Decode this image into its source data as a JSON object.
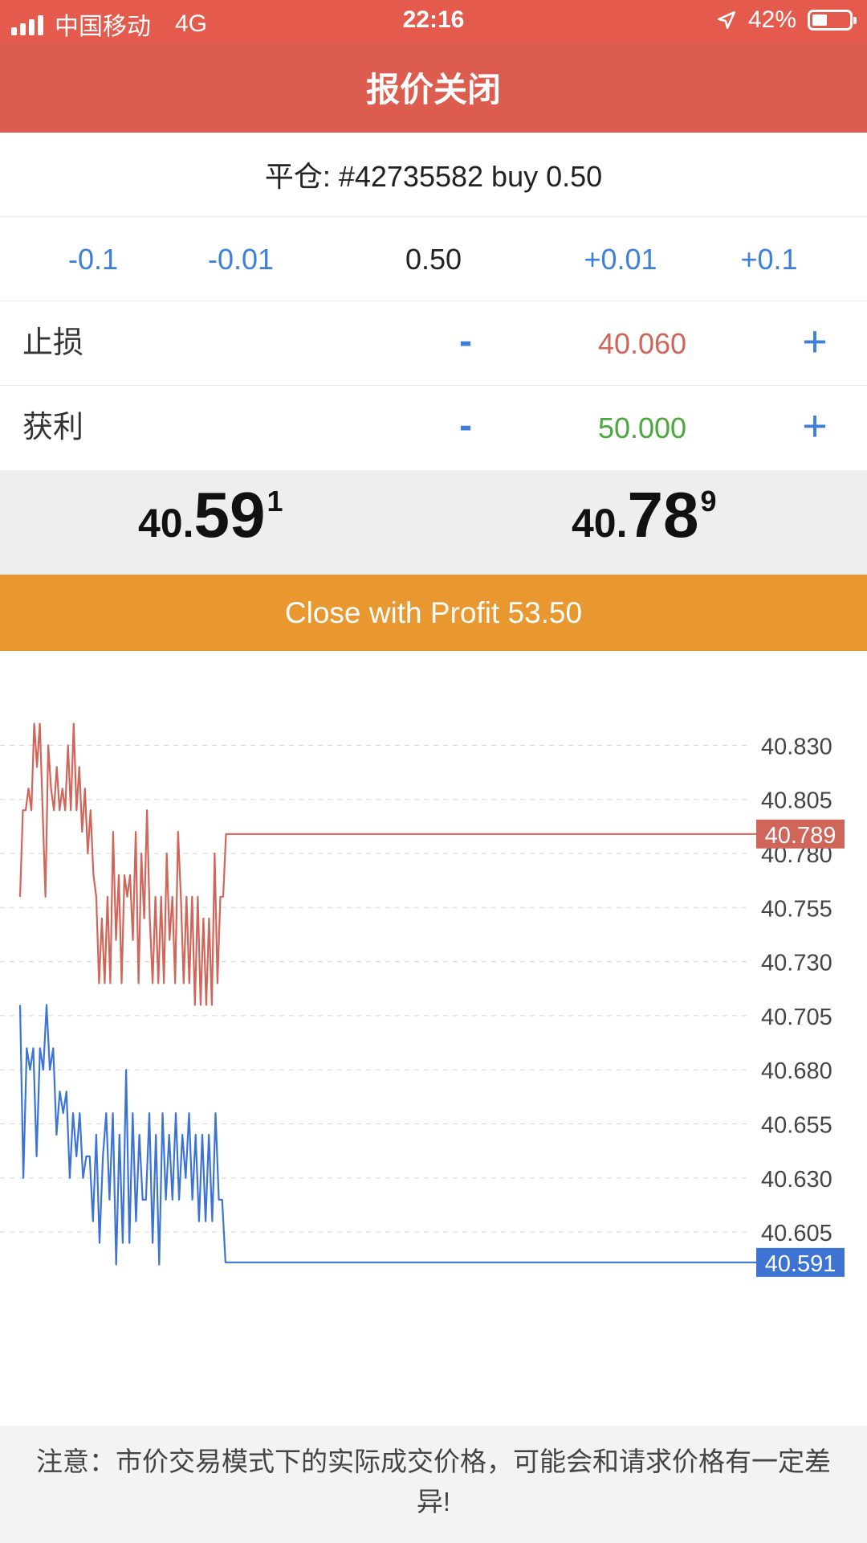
{
  "status_bar": {
    "carrier": "中国移动",
    "network": "4G",
    "time": "22:16",
    "battery": "42%",
    "battery_level": 0.42,
    "icons": [
      "signal-icon",
      "location-arrow-icon",
      "battery-icon"
    ]
  },
  "header": {
    "title": "报价关闭"
  },
  "order": {
    "title": "平仓: #42735582 buy 0.50"
  },
  "volume": {
    "minus_big": "-0.1",
    "minus_small": "-0.01",
    "value": "0.50",
    "plus_small": "+0.01",
    "plus_big": "+0.1"
  },
  "stop_loss": {
    "label": "止损",
    "minus": "-",
    "value": "40.060",
    "plus": "+"
  },
  "take_profit": {
    "label": "获利",
    "minus": "-",
    "value": "50.000",
    "plus": "+"
  },
  "prices": {
    "bid": {
      "small": "40.",
      "big": "59",
      "sup": "1"
    },
    "ask": {
      "small": "40.",
      "big": "78",
      "sup": "9"
    }
  },
  "action": {
    "close_label": "Close with Profit 53.50"
  },
  "colors": {
    "accent_red": "#dc5d4f",
    "ask_line": "#d0655a",
    "bid_line": "#3d74d4",
    "button_orange": "#e9982f",
    "take_profit_green": "#4aa83c"
  },
  "chart_data": {
    "type": "line",
    "ylim": [
      40.585,
      40.845
    ],
    "yticks": [
      "40.830",
      "40.805",
      "40.780",
      "40.755",
      "40.730",
      "40.705",
      "40.680",
      "40.655",
      "40.630",
      "40.605"
    ],
    "grid": true,
    "series": [
      {
        "values": [
          40.76,
          40.8,
          40.8,
          40.81,
          40.8,
          40.84,
          40.82,
          40.84,
          40.8,
          40.76,
          40.83,
          40.81,
          40.8,
          40.82,
          40.8,
          40.81,
          40.8,
          40.83,
          40.8,
          40.84,
          40.8,
          40.82,
          40.79,
          40.81,
          40.78,
          40.8,
          40.77,
          40.76,
          40.72,
          40.75,
          40.72,
          40.76,
          40.72,
          40.79,
          40.74,
          40.77,
          40.72,
          40.77,
          40.76,
          40.77,
          40.74,
          40.79,
          40.72,
          40.78,
          40.75,
          40.8,
          40.75,
          40.72,
          40.76,
          40.72,
          40.76,
          40.72,
          40.78,
          40.74,
          40.76,
          40.72,
          40.79,
          40.76,
          40.72,
          40.76,
          40.72,
          40.76,
          40.71,
          40.76,
          40.71,
          40.75,
          40.71,
          40.75,
          40.71,
          40.78,
          40.72,
          40.76,
          40.76,
          40.789,
          40.789
        ],
        "last": "40.789"
      },
      {
        "values": [
          40.71,
          40.63,
          40.69,
          40.68,
          40.69,
          40.64,
          40.69,
          40.68,
          40.71,
          40.68,
          40.69,
          40.65,
          40.67,
          40.66,
          40.67,
          40.63,
          40.66,
          40.64,
          40.66,
          40.63,
          40.64,
          40.64,
          40.61,
          40.65,
          40.6,
          40.64,
          40.66,
          40.62,
          40.66,
          40.59,
          40.65,
          40.6,
          40.68,
          40.6,
          40.66,
          40.61,
          40.65,
          40.62,
          40.62,
          40.66,
          40.6,
          40.65,
          40.59,
          40.66,
          40.62,
          40.65,
          40.62,
          40.66,
          40.62,
          40.65,
          40.63,
          40.66,
          40.62,
          40.65,
          40.61,
          40.65,
          40.61,
          40.65,
          40.61,
          40.66,
          40.62,
          40.62,
          40.591,
          40.591
        ],
        "last": "40.591"
      }
    ]
  },
  "footer": {
    "notice": "注意：市价交易模式下的实际成交价格，可能会和请求价格有一定差异!"
  }
}
